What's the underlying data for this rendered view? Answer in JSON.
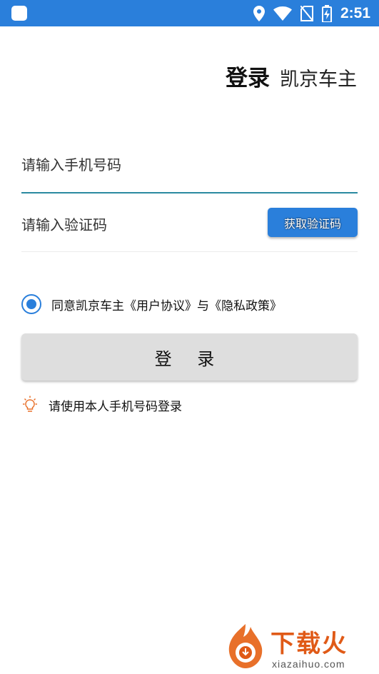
{
  "status_bar": {
    "time": "2:51",
    "icons": [
      "notification-icon",
      "location-icon",
      "wifi-icon",
      "no-sim-icon",
      "battery-charging-icon"
    ]
  },
  "header": {
    "title": "登录",
    "app_name": "凯京车主"
  },
  "form": {
    "phone_placeholder": "请输入手机号码",
    "code_placeholder": "请输入验证码",
    "get_code_label": "获取验证码"
  },
  "agreement": {
    "checked": true,
    "text": "同意凯京车主《用户协议》与《隐私政策》"
  },
  "login_button": {
    "label": "登 录"
  },
  "tip": {
    "icon": "lightbulb-icon",
    "text": "请使用本人手机号码登录"
  },
  "watermark": {
    "brand": "下载火",
    "domain": "xiazaihuo.com"
  },
  "colors": {
    "accent": "#2a7fdb",
    "input_underline": "#2a8aa0",
    "login_disabled_bg": "#dedede",
    "tip_icon": "#e8702a"
  }
}
